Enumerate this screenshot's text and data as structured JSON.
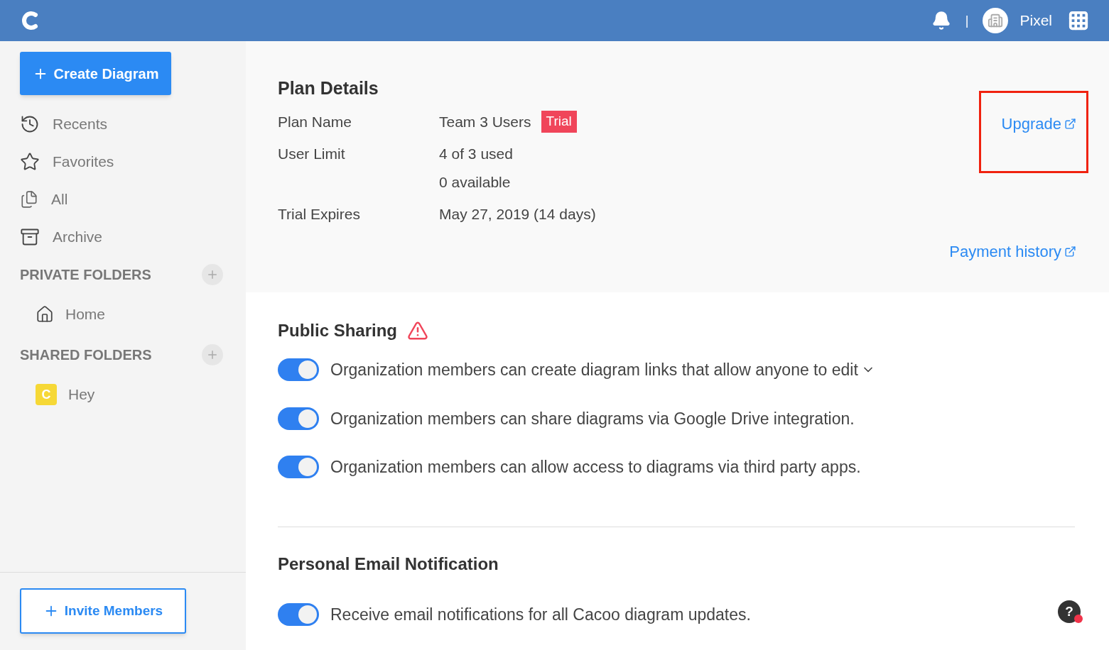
{
  "header": {
    "user": "Pixel",
    "divider": "|"
  },
  "sidebar": {
    "create_button": "Create Diagram",
    "nav": [
      {
        "label": "Recents",
        "selected": false
      },
      {
        "label": "Favorites",
        "selected": false
      },
      {
        "label": "All",
        "selected": false
      },
      {
        "label": "Archive",
        "selected": false
      }
    ],
    "sections": [
      {
        "title": "PRIVATE FOLDERS",
        "items": [
          {
            "label": "Home",
            "kind": "home"
          }
        ]
      },
      {
        "title": "SHARED FOLDERS",
        "items": [
          {
            "label": "Hey",
            "kind": "team",
            "badge": "C"
          }
        ]
      }
    ],
    "invite_button": "Invite Members"
  },
  "plan": {
    "title": "Plan Details",
    "upgrade": "Upgrade",
    "highlighted": true,
    "rows": [
      {
        "label": "Plan Name",
        "values": [
          "Team 3 Users"
        ],
        "badge": "Trial"
      },
      {
        "label": "User Limit",
        "values": [
          "4 of 3 used",
          "0 available"
        ]
      },
      {
        "label": "Trial Expires",
        "values": [
          "May 27, 2019 (14 days)"
        ]
      }
    ],
    "payment_history": "Payment history"
  },
  "public_sharing": {
    "title": "Public Sharing",
    "warning": true,
    "options": [
      {
        "label": "Organization members can create diagram links that allow anyone to edit",
        "on": true,
        "dropdown": true
      },
      {
        "label": "Organization members can share diagrams via Google Drive integration.",
        "on": true,
        "dropdown": false
      },
      {
        "label": "Organization members can allow access to diagrams via third party apps.",
        "on": true,
        "dropdown": false
      }
    ]
  },
  "email": {
    "title": "Personal Email Notification",
    "options": [
      {
        "label": "Receive email notifications for all Cacoo diagram updates.",
        "on": true
      }
    ]
  },
  "help": {
    "symbol": "?",
    "unread": true
  }
}
